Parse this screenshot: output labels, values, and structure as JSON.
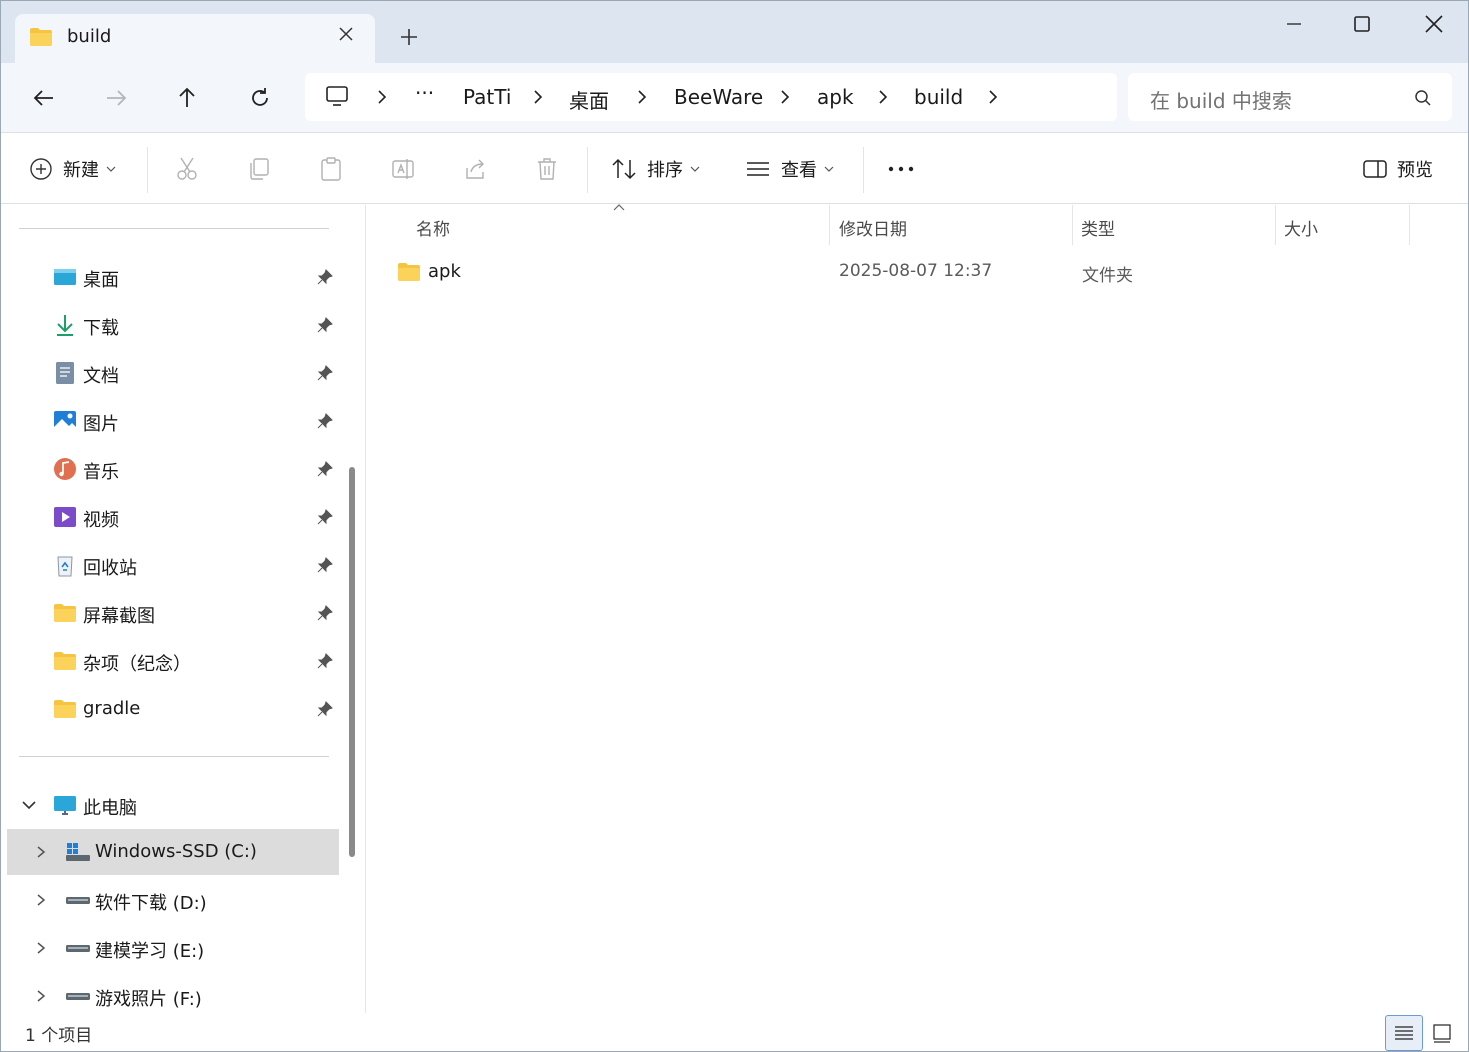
{
  "tab": {
    "title": "build",
    "icon": "folder-icon"
  },
  "window_controls": {
    "minimize": "minimize-icon",
    "maximize": "maximize-icon",
    "close": "close-icon"
  },
  "nav": {
    "back": "back-arrow-icon",
    "forward": "forward-arrow-icon",
    "up": "up-arrow-icon",
    "refresh": "refresh-icon",
    "breadcrumb": [
      "PatTi",
      "桌面",
      "BeeWare",
      "apk",
      "build"
    ],
    "overflow": "···"
  },
  "search": {
    "placeholder": "在 build 中搜索"
  },
  "commands": {
    "new_label": "新建",
    "sort_label": "排序",
    "view_label": "查看",
    "more": "···",
    "preview_label": "预览"
  },
  "sidebar": {
    "quick_access": [
      {
        "label": "桌面",
        "icon": "desktop-icon"
      },
      {
        "label": "下载",
        "icon": "download-icon"
      },
      {
        "label": "文档",
        "icon": "document-icon"
      },
      {
        "label": "图片",
        "icon": "pictures-icon"
      },
      {
        "label": "音乐",
        "icon": "music-icon"
      },
      {
        "label": "视频",
        "icon": "video-icon"
      },
      {
        "label": "回收站",
        "icon": "recycle-bin-icon"
      },
      {
        "label": "屏幕截图",
        "icon": "folder-icon"
      },
      {
        "label": "杂项（纪念）",
        "icon": "folder-icon"
      },
      {
        "label": "gradle",
        "icon": "folder-icon"
      }
    ],
    "this_pc": "此电脑",
    "drives": [
      {
        "label": "Windows-SSD (C:)",
        "selected": true
      },
      {
        "label": "软件下载 (D:)",
        "selected": false
      },
      {
        "label": "建模学习 (E:)",
        "selected": false
      },
      {
        "label": "游戏照片 (F:)",
        "selected": false
      }
    ]
  },
  "columns": {
    "name": "名称",
    "date": "修改日期",
    "type": "类型",
    "size": "大小"
  },
  "files": [
    {
      "name": "apk",
      "date": "2025-08-07 12:37",
      "type": "文件夹",
      "size": ""
    }
  ],
  "status": {
    "count": "1 个项目"
  },
  "colors": {
    "accent": "#0067c0",
    "folder": "#f5c542",
    "selected": "#dcdcdc",
    "titlebar": "#dde6f0"
  }
}
